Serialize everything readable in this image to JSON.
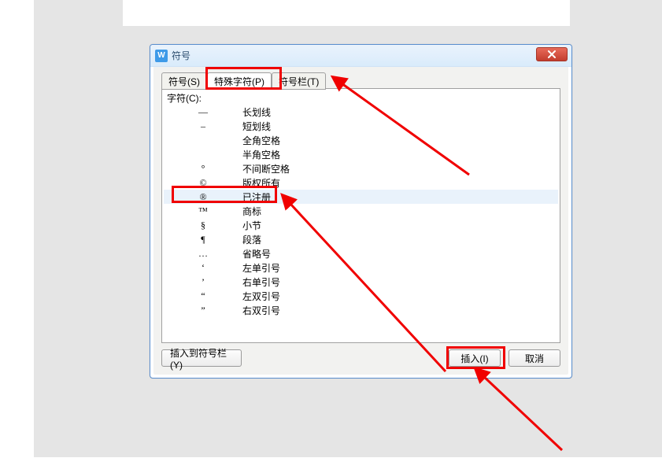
{
  "dialog": {
    "title": "符号",
    "app_icon_letter": "W",
    "tabs": [
      {
        "label": "符号(S)"
      },
      {
        "label": "特殊字符(P)"
      },
      {
        "label": "符号栏(T)"
      }
    ],
    "panel_label": "字符(C):",
    "rows": [
      {
        "glyph": "—",
        "desc": "长划线"
      },
      {
        "glyph": "–",
        "desc": "短划线"
      },
      {
        "glyph": "",
        "desc": "全角空格"
      },
      {
        "glyph": "",
        "desc": "半角空格"
      },
      {
        "glyph": "°",
        "desc": "不间断空格"
      },
      {
        "glyph": "©",
        "desc": "版权所有"
      },
      {
        "glyph": "®",
        "desc": "已注册"
      },
      {
        "glyph": "™",
        "desc": "商标"
      },
      {
        "glyph": "§",
        "desc": "小节"
      },
      {
        "glyph": "¶",
        "desc": "段落"
      },
      {
        "glyph": "…",
        "desc": "省略号"
      },
      {
        "glyph": "‘",
        "desc": "左单引号"
      },
      {
        "glyph": "’",
        "desc": "右单引号"
      },
      {
        "glyph": "“",
        "desc": "左双引号"
      },
      {
        "glyph": "”",
        "desc": "右双引号"
      }
    ],
    "selected_index": 6,
    "buttons": {
      "add_to_bar": "插入到符号栏(Y)",
      "insert": "插入(I)",
      "cancel": "取消"
    }
  }
}
